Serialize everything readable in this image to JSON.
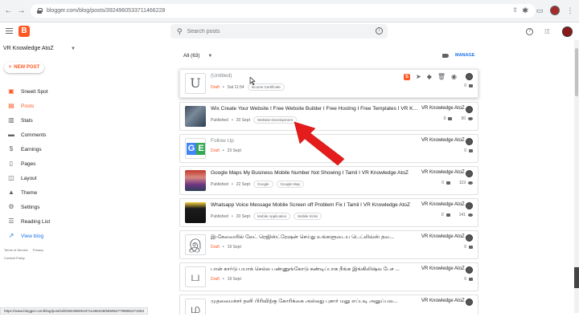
{
  "browser": {
    "url": "blogger.com/blog/posts/3924960533711466228",
    "status_url": "https://www.blogger.com/blog/post/edit/3924960533711466228/5659527799892271053"
  },
  "header": {
    "search_placeholder": "Search posts"
  },
  "sidebar": {
    "blog_name": "VR Knowledge AtoZ",
    "new_post_label": "NEW POST",
    "items": [
      {
        "label": "Sneeit Spot",
        "icon": "sneeit-icon"
      },
      {
        "label": "Posts",
        "icon": "posts-icon"
      },
      {
        "label": "Stats",
        "icon": "stats-icon"
      },
      {
        "label": "Comments",
        "icon": "comments-icon"
      },
      {
        "label": "Earnings",
        "icon": "dollar-icon"
      },
      {
        "label": "Pages",
        "icon": "pages-icon"
      },
      {
        "label": "Layout",
        "icon": "layout-icon"
      },
      {
        "label": "Theme",
        "icon": "theme-icon"
      },
      {
        "label": "Settings",
        "icon": "gear-icon"
      },
      {
        "label": "Reading List",
        "icon": "reading-list-icon"
      },
      {
        "label": "View blog",
        "icon": "view-blog-icon"
      }
    ],
    "footer": {
      "terms": "Terms of Service",
      "privacy": "Privacy",
      "content_policy": "Content Policy"
    }
  },
  "toolbar": {
    "filter_label": "All (63)",
    "manage_label": "MANAGE"
  },
  "posts": [
    {
      "title": "(Untitled)",
      "status": "Draft",
      "date": "Sat 11:54",
      "tags": [
        "Income Certificate"
      ],
      "author": "",
      "comments": "0",
      "views": "",
      "thumb_letter": "U"
    },
    {
      "title": "Wix Create Your Website I Free Website Builder I Free Hosting I Free Templates I VR Knowledge AtoZ",
      "status": "Published",
      "date": "20 Sept",
      "tags": [
        "Website Development"
      ],
      "author": "VR Knowledge AtoZ",
      "comments": "0",
      "views": "50",
      "thumb_letter": ""
    },
    {
      "title": "Follow Up",
      "status": "Draft",
      "date": "23 Sept",
      "tags": [],
      "author": "VR Knowledge AtoZ",
      "comments": "0",
      "views": "",
      "thumb_letter": ""
    },
    {
      "title": "Google Maps My Business Mobile Number Not Showing I Tamil I VR Knowledge AtoZ",
      "status": "Published",
      "date": "22 Sept",
      "tags": [
        "Google",
        "Google Map"
      ],
      "author": "VR Knowledge AtoZ",
      "comments": "0",
      "views": "119",
      "thumb_letter": ""
    },
    {
      "title": "Whatsapp Voice Message Mobile Screen off Problem Fix I Tamil I VR Knowledge AtoZ",
      "status": "Published",
      "date": "20 Sept",
      "tags": [
        "Mobile Application",
        "Mobile tricks"
      ],
      "author": "VR Knowledge AtoZ",
      "comments": "0",
      "views": "141",
      "thumb_letter": ""
    },
    {
      "title": "இ-சேவையில் லேட் ரெஜிஸ்ட்ரேஷன் செய்து உங்களுடைய டெட்லிவ்ஸ் தவ...",
      "status": "Draft",
      "date": "19 Sept",
      "tags": [],
      "author": "VR Knowledge AtoZ",
      "comments": "0",
      "views": "",
      "thumb_letter": "இ"
    },
    {
      "title": "பான் கார்டு பயாக் செல்ல பண்ணுங்கோடு கண்டிப்பாக நீங்க இங்கிலிஷ்ல பேச ...",
      "status": "Draft",
      "date": "19 Sept",
      "tags": [],
      "author": "VR Knowledge AtoZ",
      "comments": "0",
      "views": "",
      "thumb_letter": "ப"
    },
    {
      "title": "முதலமைச்சர் தனி பிரிவிற்கு கோரிக்கை அல்லது புகார் மனு எப்படி அனுப்பல...",
      "status": "Draft",
      "date": "",
      "tags": [],
      "author": "VR Knowledge AtoZ",
      "comments": "",
      "views": "",
      "thumb_letter": "ம"
    }
  ]
}
